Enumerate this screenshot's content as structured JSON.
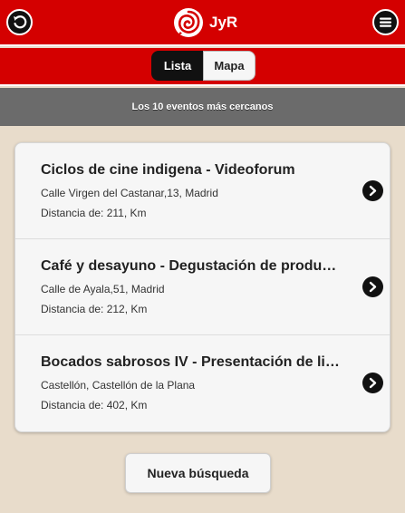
{
  "header": {
    "brand_name": "JyR",
    "back_icon": "back-arrow-icon",
    "menu_icon": "hamburger-menu-icon",
    "logo_icon": "rose-logo-icon",
    "background_color": "#d40000"
  },
  "tabs": {
    "lista_label": "Lista",
    "mapa_label": "Mapa",
    "selected": "Lista"
  },
  "subheader": {
    "text": "Los 10 eventos más cercanos"
  },
  "events": [
    {
      "title": "Ciclos de cine indigena - Videoforum",
      "address": "Calle Virgen del Castanar,13, Madrid",
      "distance": "Distancia de: 211, Km"
    },
    {
      "title": "Café y desayuno - Degustación de productos",
      "address": "Calle de Ayala,51, Madrid",
      "distance": "Distancia de: 212, Km"
    },
    {
      "title": "Bocados sabrosos IV - Presentación de libro",
      "address": "Castellón, Castellón de la Plana",
      "distance": "Distancia de: 402, Km"
    }
  ],
  "actions": {
    "new_search_label": "Nueva búsqueda"
  }
}
